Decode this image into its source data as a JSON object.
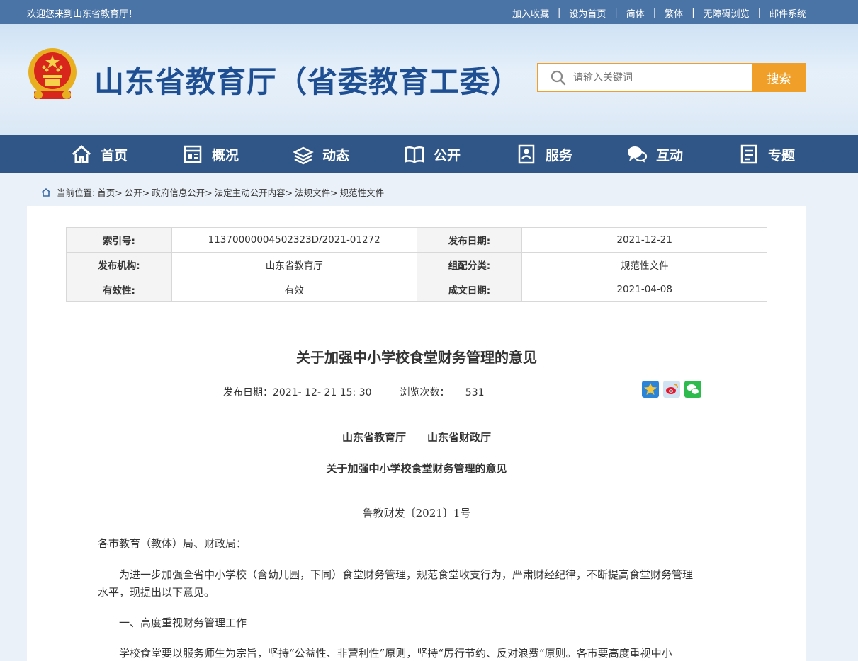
{
  "topbar": {
    "welcome": "欢迎您来到山东省教育厅！",
    "links": [
      "加入收藏",
      "设为首页",
      "简体",
      "繁体",
      "无障碍浏览",
      "邮件系统"
    ]
  },
  "header": {
    "site_title": "山东省教育厅（省委教育工委）",
    "search_placeholder": "请输入关键词",
    "search_button": "搜索"
  },
  "nav": {
    "items": [
      {
        "label": "首页",
        "icon": "home-icon"
      },
      {
        "label": "概况",
        "icon": "overview-icon"
      },
      {
        "label": "动态",
        "icon": "news-icon"
      },
      {
        "label": "公开",
        "icon": "book-icon"
      },
      {
        "label": "服务",
        "icon": "service-icon"
      },
      {
        "label": "互动",
        "icon": "chat-icon"
      },
      {
        "label": "专题",
        "icon": "topic-icon"
      }
    ]
  },
  "breadcrumb": {
    "prefix": "当前位置:",
    "items": [
      "首页>",
      "公开>",
      "政府信息公开>",
      "法定主动公开内容>",
      "法规文件>",
      "规范性文件"
    ]
  },
  "meta": {
    "rows": [
      {
        "k1": "索引号:",
        "v1": "11370000004502323D/2021-01272",
        "k2": "发布日期:",
        "v2": "2021-12-21"
      },
      {
        "k1": "发布机构:",
        "v1": "山东省教育厅",
        "k2": "组配分类:",
        "v2": "规范性文件"
      },
      {
        "k1": "有效性:",
        "v1": "有效",
        "k2": "成文日期:",
        "v2": "2021-04-08"
      }
    ]
  },
  "article": {
    "title": "关于加强中小学校食堂财务管理的意见",
    "publish_label": "发布日期：",
    "publish_date": "2021- 12- 21 15: 30",
    "views_label": "浏览次数：",
    "views": "531",
    "issuers": "山东省教育厅　　山东省财政厅",
    "doc_title": "关于加强中小学校食堂财务管理的意见",
    "doc_number": "鲁教财发〔2021〕1号",
    "salutation": "各市教育（教体）局、财政局：",
    "para1_line1": "为进一步加强全省中小学校（含幼儿园，下同）食堂财务管理，规范食堂收支行为，严肃财经纪律，不断提高食堂财务管理",
    "para1_line2": "水平，现提出以下意见。",
    "section1": "一、高度重视财务管理工作",
    "para2_line1": "学校食堂要以服务师生为宗旨，坚持“公益性、非营利性”原则，坚持“厉行节约、反对浪费”原则。各市要高度重视中小"
  },
  "colors": {
    "topbar": "#4a73a6",
    "nav": "#2f5687",
    "title": "#1f4f93",
    "accent": "#f0a028"
  }
}
